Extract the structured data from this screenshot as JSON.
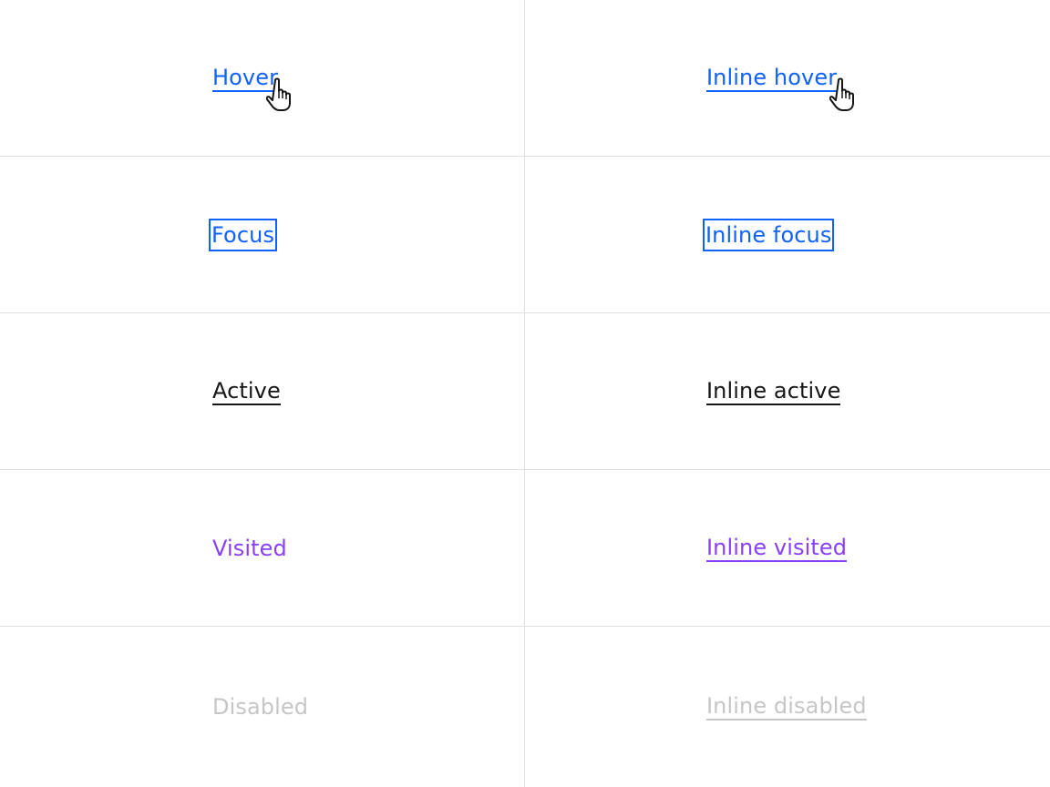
{
  "colors": {
    "link": "#0f62fe",
    "active": "#161616",
    "visited": "#8a3ffc",
    "disabled": "#c6c6c6",
    "divider": "#e0e0e0",
    "background": "#ffffff"
  },
  "rows": [
    {
      "state": "hover",
      "standalone": "Hover",
      "inline": "Inline hover"
    },
    {
      "state": "focus",
      "standalone": "Focus",
      "inline": "Inline focus"
    },
    {
      "state": "active",
      "standalone": "Active",
      "inline": "Inline active"
    },
    {
      "state": "visited",
      "standalone": "Visited",
      "inline": "Inline visited"
    },
    {
      "state": "disabled",
      "standalone": "Disabled",
      "inline": "Inline disabled"
    }
  ],
  "icons": {
    "cursor": "pointer-hand-icon"
  }
}
